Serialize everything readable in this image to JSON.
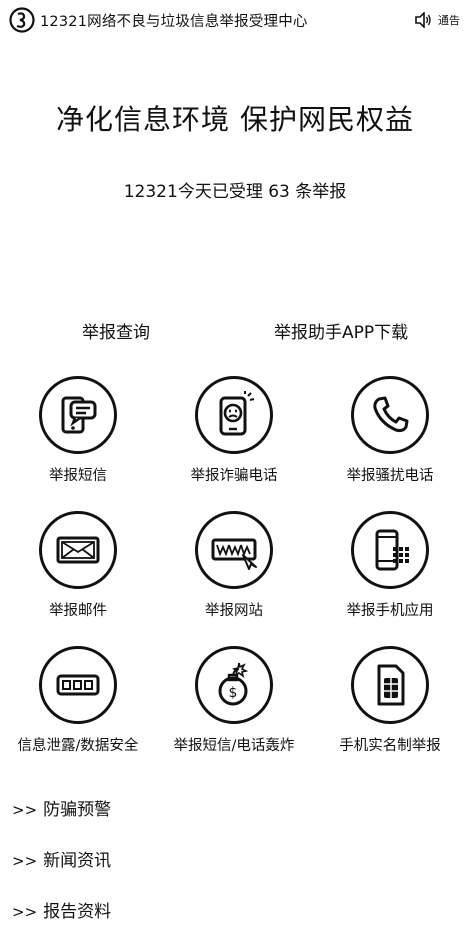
{
  "header": {
    "title": "12321网络不良与垃圾信息举报受理中心",
    "notice_label": "通告",
    "logo_icon": "12321-logo-icon",
    "notice_icon": "speaker-icon"
  },
  "hero": {
    "slogan": "净化信息环境 保护网民权益",
    "counter": "12321今天已受理 63 条举报"
  },
  "quick_links": {
    "query": "举报查询",
    "app_download": "举报助手APP下载"
  },
  "report_items": [
    {
      "label": "举报短信",
      "icon": "sms-phone-icon"
    },
    {
      "label": "举报诈骗电话",
      "icon": "fraud-phone-icon"
    },
    {
      "label": "举报骚扰电话",
      "icon": "handset-icon"
    },
    {
      "label": "举报邮件",
      "icon": "envelope-icon"
    },
    {
      "label": "举报网站",
      "icon": "website-www-icon"
    },
    {
      "label": "举报手机应用",
      "icon": "mobile-app-icon"
    },
    {
      "label": "信息泄露/数据安全",
      "icon": "data-leak-icon"
    },
    {
      "label": "举报短信/电话轰炸",
      "icon": "bomb-icon"
    },
    {
      "label": "手机实名制举报",
      "icon": "sim-card-icon"
    }
  ],
  "sections": {
    "arrow": ">>",
    "items": [
      "防骗预警",
      "新闻资讯",
      "报告资料"
    ]
  }
}
